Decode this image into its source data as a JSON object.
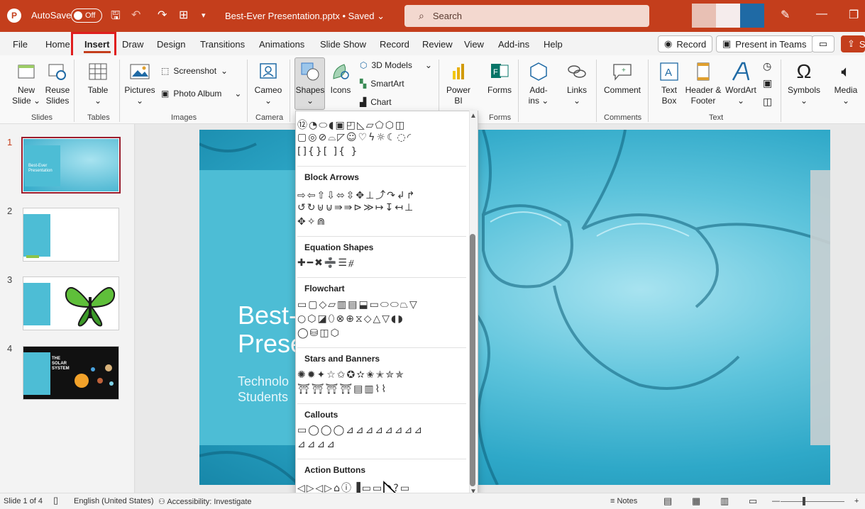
{
  "titlebar": {
    "autosave_label": "AutoSave",
    "autosave_state": "Off",
    "file_name": "Best-Ever Presentation.pptx • Saved",
    "search_placeholder": "Search"
  },
  "menu": {
    "tabs": [
      "File",
      "Home",
      "Insert",
      "Draw",
      "Design",
      "Transitions",
      "Animations",
      "Slide Show",
      "Record",
      "Review",
      "View",
      "Add-ins",
      "Help"
    ],
    "active": "Insert",
    "record_btn": "Record",
    "present_btn": "Present in Teams",
    "share_btn": "Sh"
  },
  "ribbon": {
    "new_slide": "New Slide",
    "reuse_slides": "Reuse Slides",
    "table": "Table",
    "pictures": "Pictures",
    "screenshot": "Screenshot",
    "photo_album": "Photo Album",
    "cameo": "Cameo",
    "shapes": "Shapes",
    "icons": "Icons",
    "models_3d": "3D Models",
    "smartart": "SmartArt",
    "chart": "Chart",
    "power_bi": "Power BI",
    "forms": "Forms",
    "add_ins": "Add-ins",
    "links": "Links",
    "comment": "Comment",
    "text_box": "Text Box",
    "header_footer": "Header & Footer",
    "wordart": "WordArt",
    "symbols": "Symbols",
    "media": "Media",
    "groups": {
      "slides": "Slides",
      "tables": "Tables",
      "images": "Images",
      "camera": "Camera",
      "forms": "Forms",
      "comments": "Comments",
      "text": "Text"
    }
  },
  "slides": {
    "numbers": [
      "1",
      "2",
      "3",
      "4"
    ],
    "thumb1_title": "Best-Ever Presentation",
    "thumb4_title": "THE SOLAR SYSTEM"
  },
  "slide_main": {
    "title_line1": "Best-",
    "title_line2": "Prese",
    "sub_line1": "Technolo",
    "sub_line2": "Students"
  },
  "shapes_menu": {
    "sections": [
      "Block Arrows",
      "Equation Shapes",
      "Flowchart",
      "Stars and Banners",
      "Callouts",
      "Action Buttons"
    ],
    "rows": {
      "top_partial": "⌒⌒⌒⌒⌒⌒⌒⌒⌒⌒⌒",
      "basic1": "⑫◔⬭◖▣◰◺▱⬠⬡◫",
      "basic2": "▢◎⊘⌓◸☺♡ϟ☼☾◌◜",
      "basic3": "[]{}[ ]{ }",
      "arrows1": "⇨⇦⇧⇩⬄⇳✥⊥⤴↷↲↱",
      "arrows2": "↺↻⊎⊍⇛⇛⊳≫↦↧↤⊥",
      "arrows3": "✥✧⋒",
      "equation": "✚━✖➗☰⧣",
      "flow1": "▭▢◇▱▥▤⬓▭⬭⬭⏢▽",
      "flow2": "○⬡◪⬯⊗⊕⧖◇△▽◖◗",
      "flow3": "◯⛁◫⬡",
      "stars1": "✺✹✦☆✩✪✫✬✭✮✯",
      "stars2": "⛩⛩⛩⛩▤▥⌇⌇",
      "callouts1": "▭◯◯◯⊿⊿⊿⊿⊿⊿⊿⊿",
      "callouts2": "⊿⊿⊿⊿",
      "actions": "◁▷◁▷⌂ⓘ▐▭▭◔?▭"
    }
  },
  "status": {
    "slide_count": "Slide 1 of 4",
    "language": "English (United States)",
    "accessibility": "Accessibility: Investigate",
    "notes": "Notes"
  },
  "colors": {
    "accent": "#c43e1c",
    "slide_blue": "#4dbdd5"
  }
}
